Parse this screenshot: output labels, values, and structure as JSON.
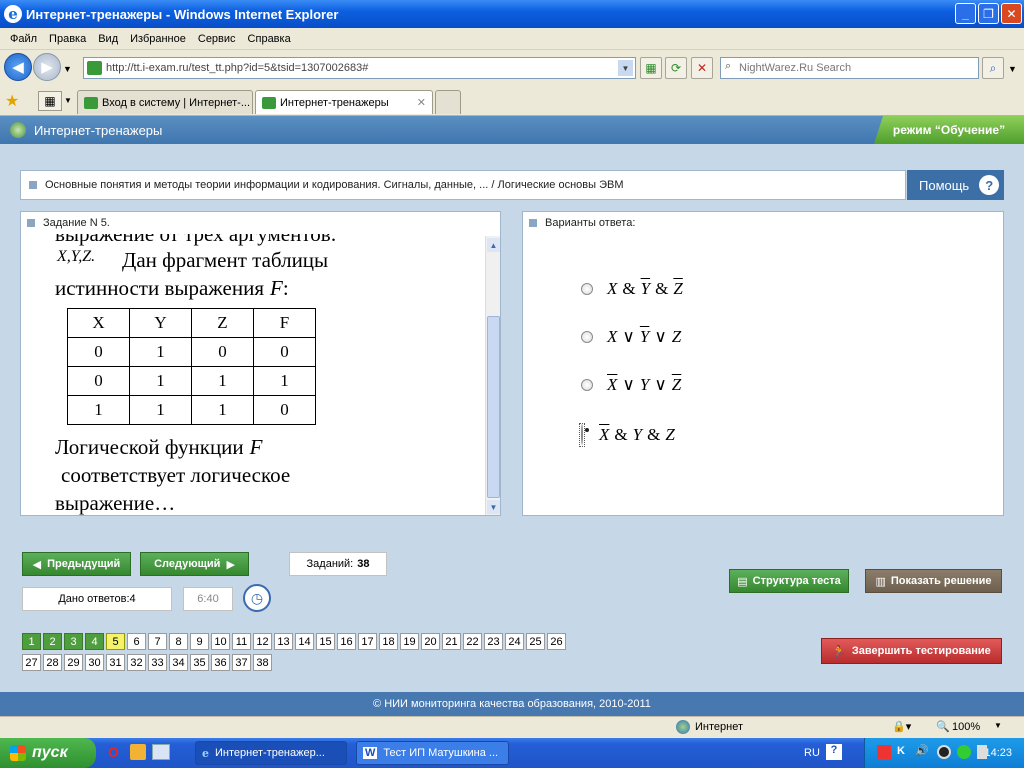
{
  "window": {
    "title": "Интернет-тренажеры - Windows Internet Explorer",
    "minimize_icon": "_",
    "maximize_icon": "❐",
    "close_icon": "✕"
  },
  "menu": [
    "Файл",
    "Правка",
    "Вид",
    "Избранное",
    "Сервис",
    "Справка"
  ],
  "address": {
    "url": "http://tt.i-exam.ru/test_tt.php?id=5&tsid=1307002683#",
    "search_placeholder": "NightWarez.Ru Search"
  },
  "tabs": [
    {
      "label": "Вход в систему | Интернет-..."
    },
    {
      "label": "Интернет-тренажеры"
    }
  ],
  "app": {
    "title": "Интернет-тренажеры",
    "mode": "режим “Обучение”"
  },
  "breadcrumb": "Основные понятия и методы теории информации и кодирования. Сигналы, данные, ... / Логические основы ЭВМ",
  "help_label": "Помощь",
  "task": {
    "header": "Задание N 5.",
    "text_top": "выражение от трех аргументов:",
    "vars": "X,Y,Z.",
    "text_a": "Дан фрагмент таблицы",
    "text_b": "истинности выражения",
    "func": "F",
    "colon": ":",
    "table": {
      "headers": [
        "X",
        "Y",
        "Z",
        "F"
      ],
      "rows": [
        [
          "0",
          "1",
          "0",
          "0"
        ],
        [
          "0",
          "1",
          "1",
          "1"
        ],
        [
          "1",
          "1",
          "1",
          "0"
        ]
      ]
    },
    "text_c": "Логической функции",
    "text_d": "соответствует логическое",
    "text_e": "выражение…"
  },
  "answers": {
    "header": "Варианты ответа:",
    "options": [
      {
        "a": "X",
        "op1": "&",
        "b": "Y",
        "op2": "&",
        "c": "Z",
        "selected": false
      },
      {
        "a": "X",
        "op1": "∨",
        "b": "Y",
        "op2": "∨",
        "c": "Z",
        "selected": false
      },
      {
        "a": "X",
        "op1": "∨",
        "b": "Y",
        "op2": "∨",
        "c": "Z",
        "selected": false
      },
      {
        "a": "X",
        "op1": "&",
        "b": "Y",
        "op2": "&",
        "c": "Z",
        "selected": true
      }
    ]
  },
  "nav": {
    "prev": "Предыдущий",
    "next": "Следующий",
    "tasks_label": "Заданий:",
    "tasks_count": "38",
    "answered_label": "Дано ответов:",
    "answered_count": "4",
    "timer": "6:40",
    "structure": "Структура теста",
    "show_solution": "Показать решение",
    "finish": "Завершить тестирование"
  },
  "pages": {
    "row1": [
      "1",
      "2",
      "3",
      "4",
      "5",
      "6",
      "7",
      "8",
      "9",
      "10",
      "11",
      "12",
      "13",
      "14",
      "15",
      "16",
      "17",
      "18",
      "19",
      "20",
      "21",
      "22",
      "23",
      "24",
      "25",
      "26"
    ],
    "row2": [
      "27",
      "28",
      "29",
      "30",
      "31",
      "32",
      "33",
      "34",
      "35",
      "36",
      "37",
      "38"
    ],
    "done": [
      "1",
      "2",
      "3",
      "4"
    ],
    "current": "5"
  },
  "footer": "© НИИ мониторинга качества образования, 2010-2011",
  "status": {
    "zone": "Интернет",
    "zoom": "100%"
  },
  "taskbar": {
    "start": "пуск",
    "tasks": [
      "Интернет-тренажер...",
      "Тест ИП Матушкина ..."
    ],
    "lang": "RU",
    "clock": "14:23"
  }
}
